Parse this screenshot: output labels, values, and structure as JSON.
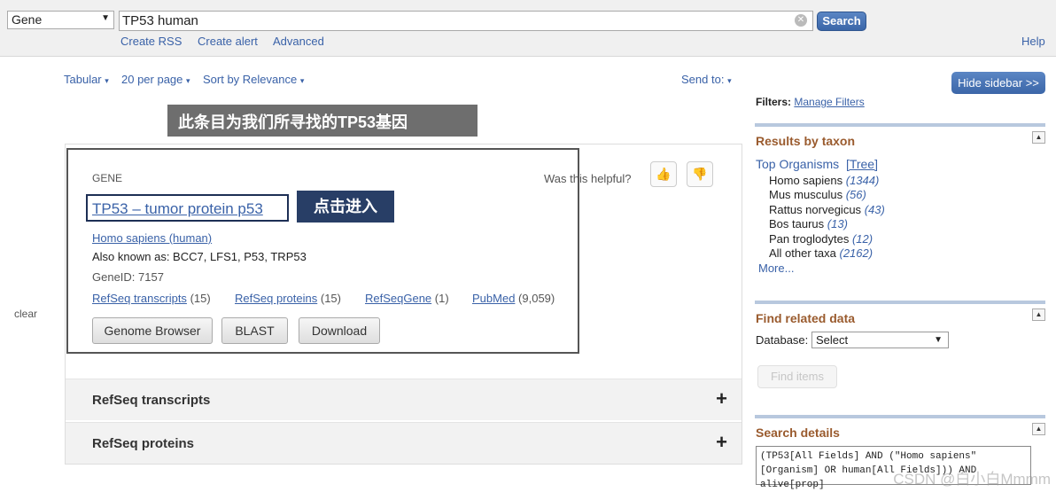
{
  "search": {
    "database": "Gene",
    "query": "TP53 human",
    "button": "Search",
    "links": [
      "Create RSS",
      "Create alert",
      "Advanced"
    ],
    "help": "Help"
  },
  "toolbar": {
    "format": "Tabular",
    "per_page": "20 per page",
    "sort": "Sort by Relevance",
    "send_to": "Send to:"
  },
  "clear": "clear",
  "annotations": {
    "highlight_note": "此条目为我们所寻找的TP53基因",
    "click_note": "点击进入"
  },
  "result": {
    "type_label": "GENE",
    "helpful": "Was this helpful?",
    "title": "TP53 – tumor protein p53",
    "organism": "Homo sapiens (human)",
    "also_known_as": "Also known as: BCC7, LFS1, P53, TRP53",
    "gene_id": "GeneID: 7157",
    "links": [
      {
        "name": "RefSeq transcripts",
        "count": "(15)"
      },
      {
        "name": "RefSeq proteins",
        "count": "(15)"
      },
      {
        "name": "RefSeqGene",
        "count": "(1)"
      },
      {
        "name": "PubMed",
        "count": "(9,059)"
      }
    ],
    "buttons": [
      "Genome Browser",
      "BLAST",
      "Download"
    ]
  },
  "sections": [
    "RefSeq transcripts",
    "RefSeq proteins"
  ],
  "sidebar": {
    "hide_button": "Hide sidebar >>",
    "filters_label": "Filters:",
    "manage_filters": "Manage Filters",
    "taxon_heading": "Results by taxon",
    "top_organisms": "Top Organisms",
    "tree": "[Tree]",
    "taxa": [
      {
        "name": "Homo sapiens",
        "count": "(1344)"
      },
      {
        "name": "Mus musculus",
        "count": "(56)"
      },
      {
        "name": "Rattus norvegicus",
        "count": "(43)"
      },
      {
        "name": "Bos taurus",
        "count": "(13)"
      },
      {
        "name": "Pan troglodytes",
        "count": "(12)"
      },
      {
        "name": "All other taxa",
        "count": "(2162)"
      }
    ],
    "more": "More...",
    "related_heading": "Find related data",
    "database_label": "Database:",
    "database_value": "Select",
    "find_items": "Find items",
    "details_heading": "Search details",
    "details_text": "(TP53[All Fields] AND (\"Homo sapiens\"[Organism] OR human[All Fields])) AND alive[prop]"
  },
  "watermark": "CSDN @白小白Mmmm"
}
